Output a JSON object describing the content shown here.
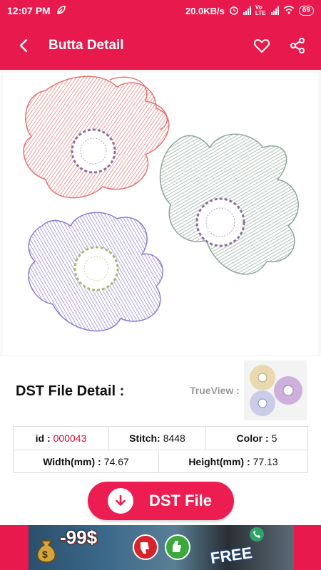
{
  "status_bar": {
    "time": "12:07 PM",
    "network_speed": "20.0KB/s",
    "volte_label": "Vo LTE",
    "battery": "69"
  },
  "app_bar": {
    "title": "Butta Detail",
    "back_icon": "arrow-left-icon",
    "favorite_icon": "heart-outline-icon",
    "share_icon": "share-icon"
  },
  "design": {
    "thread_colors": [
      "#e8726f",
      "#8e7ad6",
      "#8fa69a",
      "#8c6f9c",
      "#a7b86a"
    ]
  },
  "detail": {
    "heading": "DST File Detail :",
    "trueview_label": "TrueView :"
  },
  "info": {
    "id_label": "id :",
    "id_value": "000043",
    "stitch_label": "Stitch:",
    "stitch_value": "8448",
    "color_label": "Color :",
    "color_value": "5",
    "width_label": "Width(mm) :",
    "width_value": "74.67",
    "height_label": "Height(mm) :",
    "height_value": "77.13"
  },
  "download_button": {
    "label": "DST File",
    "icon": "arrow-down-circle-icon"
  },
  "ad": {
    "price_text": "-99$",
    "free_text": "FREE"
  },
  "colors": {
    "primary": "#e81a4d",
    "accent_text": "#d0103a"
  }
}
